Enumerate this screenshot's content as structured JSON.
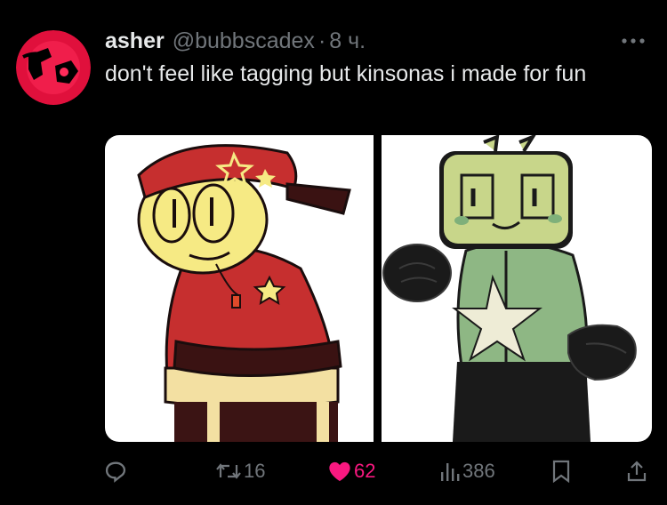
{
  "tweet": {
    "author_name": "asher",
    "handle": "@bubbscadex",
    "separator": "·",
    "time": "8 ч.",
    "text": "don't feel like tagging but kinsonas i made for fun"
  },
  "media": [
    {
      "icon": "drawing-character-red-bandana"
    },
    {
      "icon": "drawing-character-tv-head"
    }
  ],
  "actions": {
    "reply": {
      "icon": "reply-icon",
      "count": ""
    },
    "retweet": {
      "icon": "retweet-icon",
      "count": "16"
    },
    "like": {
      "icon": "heart-icon",
      "count": "62",
      "liked": true
    },
    "views": {
      "icon": "views-icon",
      "count": "386"
    },
    "bookmark": {
      "icon": "bookmark-icon"
    },
    "share": {
      "icon": "share-icon"
    }
  },
  "colors": {
    "background": "#000000",
    "text": "#e7e9ea",
    "secondary": "#71767b",
    "like": "#f91880",
    "accent": "#1d9bf0"
  }
}
